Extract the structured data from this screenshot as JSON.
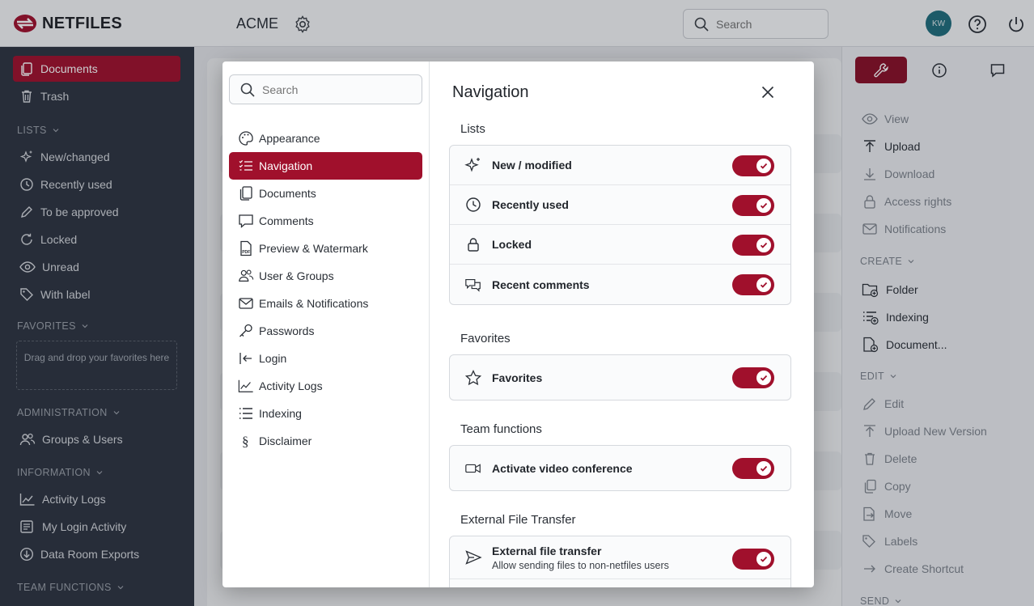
{
  "topbar": {
    "brand": "NETFILES",
    "company": "ACME",
    "search_placeholder": "Search",
    "avatar_initials": "KW"
  },
  "sidebar": {
    "items_top": [
      {
        "label": "Documents",
        "icon": "documents-icon",
        "active": true
      },
      {
        "label": "Trash",
        "icon": "trash-icon"
      }
    ],
    "lists_header": "LISTS",
    "lists": [
      {
        "label": "New/changed",
        "icon": "sparkle-icon"
      },
      {
        "label": "Recently used",
        "icon": "clock-icon"
      },
      {
        "label": "To be approved",
        "icon": "pencil-icon"
      },
      {
        "label": "Locked",
        "icon": "refresh-icon"
      },
      {
        "label": "Unread",
        "icon": "eye-icon"
      },
      {
        "label": "With label",
        "icon": "tag-icon"
      }
    ],
    "favorites_header": "FAVORITES",
    "favorites_drop": "Drag and drop your favorites here",
    "administration_header": "ADMINISTRATION",
    "administration": [
      {
        "label": "Groups & Users",
        "icon": "users-icon"
      }
    ],
    "information_header": "INFORMATION",
    "information": [
      {
        "label": "Activity Logs",
        "icon": "chart-icon"
      },
      {
        "label": "My Login Activity",
        "icon": "list-icon"
      },
      {
        "label": "Data Room Exports",
        "icon": "download-circle-icon"
      }
    ],
    "team_header": "TEAM FUNCTIONS"
  },
  "right_panel": {
    "actions": [
      {
        "label": "View",
        "icon": "eye-icon",
        "enabled": false
      },
      {
        "label": "Upload",
        "icon": "upload-icon",
        "enabled": true
      },
      {
        "label": "Download",
        "icon": "download-icon",
        "enabled": false
      },
      {
        "label": "Access rights",
        "icon": "lock-icon",
        "enabled": false
      },
      {
        "label": "Notifications",
        "icon": "mail-icon",
        "enabled": false
      }
    ],
    "create_header": "CREATE",
    "create": [
      {
        "label": "Folder",
        "icon": "folder-plus-icon"
      },
      {
        "label": "Indexing",
        "icon": "indexing-icon"
      },
      {
        "label": "Document...",
        "icon": "document-plus-icon"
      }
    ],
    "edit_header": "EDIT",
    "edit": [
      {
        "label": "Edit",
        "icon": "pencil-icon"
      },
      {
        "label": "Upload New Version",
        "icon": "upload-icon"
      },
      {
        "label": "Delete",
        "icon": "trash-icon"
      },
      {
        "label": "Copy",
        "icon": "copy-icon"
      },
      {
        "label": "Move",
        "icon": "move-icon"
      },
      {
        "label": "Labels",
        "icon": "tag-icon"
      },
      {
        "label": "Create Shortcut",
        "icon": "arrow-right-icon"
      }
    ],
    "send_header": "SEND"
  },
  "modal": {
    "search_placeholder": "Search",
    "menu": [
      {
        "label": "Appearance",
        "icon": "palette-icon"
      },
      {
        "label": "Navigation",
        "icon": "list-check-icon",
        "active": true
      },
      {
        "label": "Documents",
        "icon": "documents-icon"
      },
      {
        "label": "Comments",
        "icon": "comment-icon"
      },
      {
        "label": "Preview & Watermark",
        "icon": "pdf-icon"
      },
      {
        "label": "User & Groups",
        "icon": "users-icon"
      },
      {
        "label": "Emails & Notifications",
        "icon": "mail-icon"
      },
      {
        "label": "Passwords",
        "icon": "key-icon"
      },
      {
        "label": "Login",
        "icon": "login-icon"
      },
      {
        "label": "Activity Logs",
        "icon": "chart-icon"
      },
      {
        "label": "Indexing",
        "icon": "indexing-icon"
      },
      {
        "label": "Disclaimer",
        "icon": "paragraph-icon"
      }
    ],
    "title": "Navigation",
    "groups": {
      "lists": {
        "title": "Lists",
        "rows": [
          {
            "label": "New / modified",
            "icon": "sparkle-icon",
            "on": true
          },
          {
            "label": "Recently used",
            "icon": "clock-icon",
            "on": true
          },
          {
            "label": "Locked",
            "icon": "lock-icon",
            "on": true
          },
          {
            "label": "Recent comments",
            "icon": "comments-icon",
            "on": true
          }
        ]
      },
      "favorites": {
        "title": "Favorites",
        "rows": [
          {
            "label": "Favorites",
            "icon": "star-icon",
            "on": true
          }
        ]
      },
      "team": {
        "title": "Team functions",
        "rows": [
          {
            "label": "Activate video conference",
            "icon": "video-icon",
            "on": true
          }
        ]
      },
      "external": {
        "title": "External File Transfer",
        "rows": [
          {
            "label": "External file transfer",
            "sub": "Allow sending files to non-netfiles users",
            "icon": "send-icon",
            "on": true
          }
        ]
      }
    }
  },
  "colors": {
    "accent": "#a0102c",
    "sidebar_bg": "#2d3440",
    "avatar_bg": "#1f6e7d"
  }
}
